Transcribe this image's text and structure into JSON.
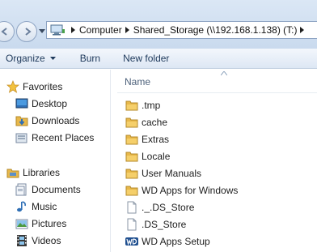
{
  "address": {
    "crumbs": [
      "Computer",
      "Shared_Storage (\\\\192.168.1.138) (T:)"
    ]
  },
  "toolbar": {
    "organize": "Organize",
    "burn": "Burn",
    "new_folder": "New folder"
  },
  "sidebar": {
    "favorites": {
      "label": "Favorites",
      "items": [
        "Desktop",
        "Downloads",
        "Recent Places"
      ]
    },
    "libraries": {
      "label": "Libraries",
      "items": [
        "Documents",
        "Music",
        "Pictures",
        "Videos"
      ]
    }
  },
  "content": {
    "column_name": "Name",
    "files": [
      {
        "name": ".tmp",
        "icon": "folder-icon"
      },
      {
        "name": "cache",
        "icon": "folder-icon"
      },
      {
        "name": "Extras",
        "icon": "folder-icon"
      },
      {
        "name": "Locale",
        "icon": "folder-icon"
      },
      {
        "name": "User Manuals",
        "icon": "folder-icon"
      },
      {
        "name": "WD Apps for Windows",
        "icon": "folder-icon"
      },
      {
        "name": "._.DS_Store",
        "icon": "file-icon"
      },
      {
        "name": ".DS_Store",
        "icon": "file-icon"
      },
      {
        "name": "WD Apps Setup",
        "icon": "wd-app-icon"
      }
    ]
  },
  "colors": {
    "folder": "#e8b84a",
    "toolbar_text": "#1e395b",
    "header_text": "#4c607a"
  }
}
